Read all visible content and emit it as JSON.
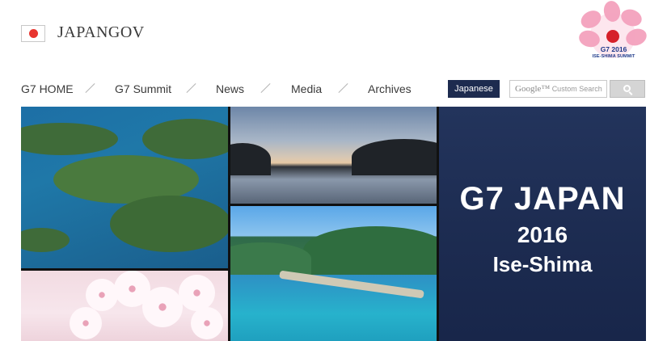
{
  "header": {
    "brand": "JAPANGOV",
    "summit_logo": {
      "year": "G7 2016",
      "name": "ISE-SHIMA SUMMIT"
    }
  },
  "nav": {
    "items": [
      {
        "label": "G7 HOME"
      },
      {
        "label": "G7 Summit"
      },
      {
        "label": "News"
      },
      {
        "label": "Media"
      },
      {
        "label": "Archives"
      }
    ],
    "language_button": "Japanese",
    "search": {
      "brand": "Google™",
      "placeholder": "Custom Search"
    }
  },
  "hero": {
    "line1": "G7 JAPAN",
    "line2": "2016",
    "line3": "Ise-Shima"
  },
  "colors": {
    "navy": "#1d2b4f",
    "flag_red": "#e8352f",
    "logo_pink": "#f3a1bd"
  }
}
